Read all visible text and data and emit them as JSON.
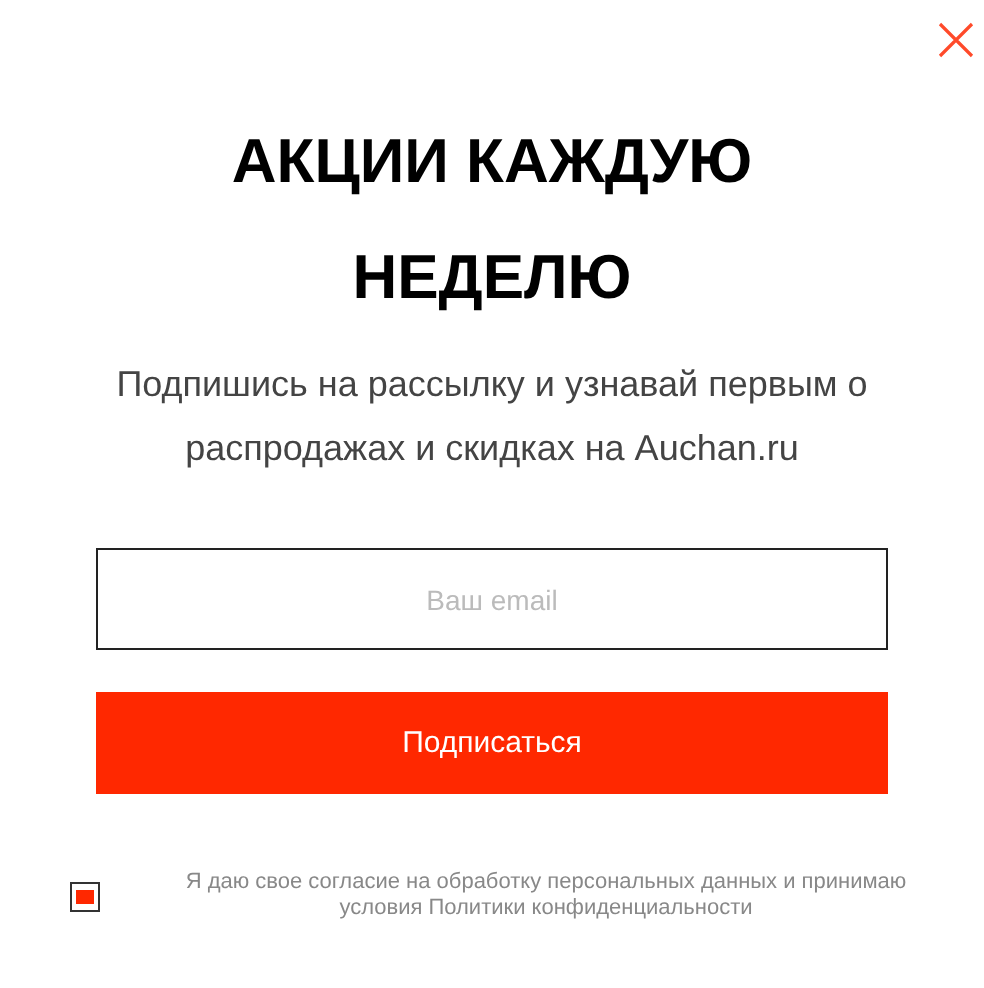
{
  "title": "АКЦИИ КАЖДУЮ НЕДЕЛЮ",
  "subtitle": "Подпишись на рассылку и узнавай первым о распродажах и скидках на Auchan.ru",
  "email": {
    "placeholder": "Ваш email"
  },
  "submit_button": "Подписаться",
  "consent": {
    "checked": true,
    "text": "Я даю свое согласие на обработку персональных данных и принимаю условия Политики конфиденциальности"
  }
}
